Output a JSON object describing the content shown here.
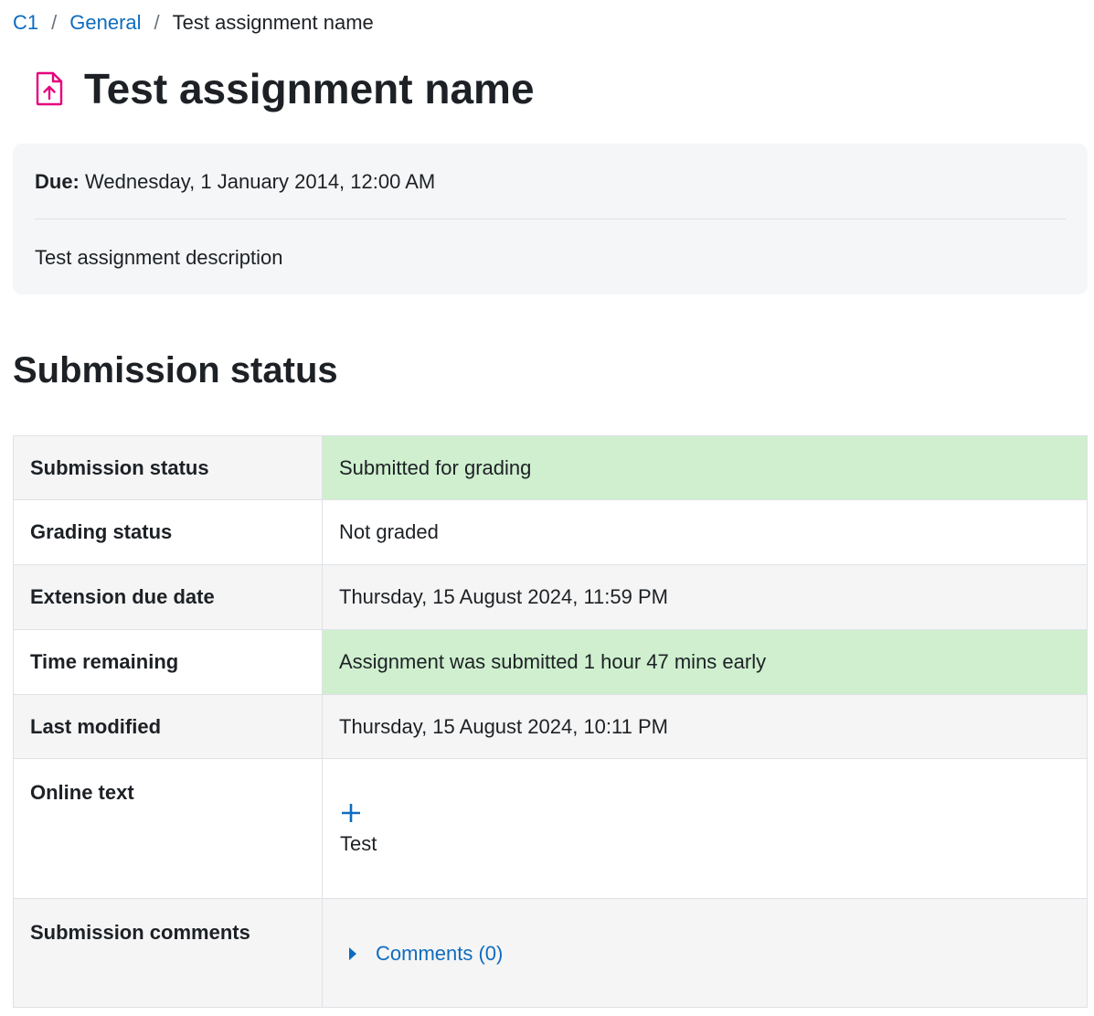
{
  "breadcrumb": {
    "items": [
      {
        "label": "C1"
      },
      {
        "label": "General"
      }
    ],
    "separator": "/",
    "current": "Test assignment name"
  },
  "page": {
    "title": "Test assignment name",
    "icon": "assignment-upload-icon",
    "icon_color": "#e6007e"
  },
  "info": {
    "due_label": "Due:",
    "due_value": "Wednesday, 1 January 2014, 12:00 AM",
    "description": "Test assignment description"
  },
  "submission": {
    "section_title": "Submission status",
    "rows": [
      {
        "label": "Submission status",
        "value": "Submitted for grading"
      },
      {
        "label": "Grading status",
        "value": "Not graded"
      },
      {
        "label": "Extension due date",
        "value": "Thursday, 15 August 2024, 11:59 PM"
      },
      {
        "label": "Time remaining",
        "value": "Assignment was submitted 1 hour 47 mins early"
      },
      {
        "label": "Last modified",
        "value": "Thursday, 15 August 2024, 10:11 PM"
      },
      {
        "label": "Online text",
        "value": "Test"
      },
      {
        "label": "Submission comments",
        "value": "Comments (0)"
      }
    ]
  },
  "colors": {
    "link": "#0f6cbf",
    "success_bg": "#cfefcf",
    "text": "#1d2125"
  }
}
